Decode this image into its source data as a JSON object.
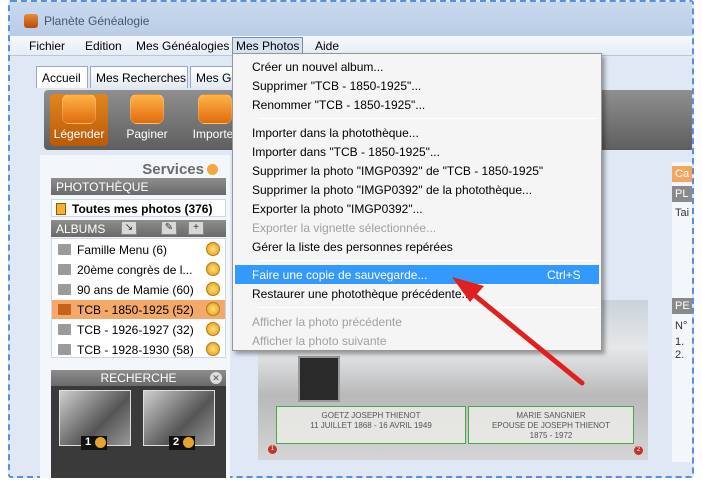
{
  "app": {
    "title": "Planète Généalogie"
  },
  "menubar": [
    "Fichier",
    "Edition",
    "Mes Généalogies",
    "Mes Photos",
    "Aide"
  ],
  "tabs": [
    "Accueil",
    "Mes Recherches",
    "Mes Gé"
  ],
  "toolbar": [
    "Légender",
    "Paginer",
    "Importer"
  ],
  "services": {
    "title": "Services"
  },
  "phototheque": {
    "title": "PHOTOTHÈQUE",
    "all_photos": "Toutes mes photos (376)"
  },
  "albums": {
    "title": "ALBUMS",
    "items": [
      "Famille Menu (6)",
      "20ème congrès de l...",
      "90 ans de Mamie (60)",
      "TCB - 1850-1925 (52)",
      "TCB - 1926-1927 (32)",
      "TCB - 1928-1930 (58)"
    ],
    "selected_index": 3
  },
  "recherche": {
    "title": "RECHERCHE",
    "thumbs": [
      "1",
      "2"
    ]
  },
  "photo": {
    "plaque_left": "GOETZ JOSEPH THIENOT\n11 JUILLET 1868 - 16 AVRIL 1949",
    "plaque_right": "MARIE SANGNIER\nEPOUSE DE JOSEPH THIENOT\n1875 - 1972",
    "corner_left": "1",
    "corner_right": "2"
  },
  "right_panel": {
    "tab1": "Ca",
    "label1": "PL",
    "text1": "Tai",
    "label2": "PE",
    "text2": "N°",
    "text3": "1.",
    "text4": "2."
  },
  "dropdown": {
    "items": [
      {
        "label": "Créer un nouvel album...",
        "enabled": true
      },
      {
        "label": "Supprimer \"TCB - 1850-1925\"...",
        "enabled": true
      },
      {
        "label": "Renommer \"TCB - 1850-1925\"...",
        "enabled": true
      },
      {
        "label": "Importer dans la photothèque...",
        "enabled": true
      },
      {
        "label": "Importer dans \"TCB - 1850-1925\"...",
        "enabled": true
      },
      {
        "label": "Supprimer la photo \"IMGP0392\" de \"TCB - 1850-1925\"",
        "enabled": true
      },
      {
        "label": "Supprimer la photo \"IMGP0392\" de la photothèque...",
        "enabled": true
      },
      {
        "label": "Exporter la photo \"IMGP0392\"...",
        "enabled": true
      },
      {
        "label": "Exporter la vignette sélectionnée...",
        "enabled": false
      },
      {
        "label": "Gérer la liste des personnes repérées",
        "enabled": true
      },
      {
        "label": "Faire une copie de sauvegarde...",
        "enabled": true,
        "shortcut": "Ctrl+S",
        "highlighted": true
      },
      {
        "label": "Restaurer une photothèque précédente...",
        "enabled": true
      },
      {
        "label": "Afficher la photo précédente",
        "enabled": false
      },
      {
        "label": "Afficher la photo suivante",
        "enabled": false
      }
    ]
  },
  "colors": {
    "highlight": "#3399ff",
    "selected_album": "#f4a86a",
    "annotation_arrow": "#e02020"
  }
}
